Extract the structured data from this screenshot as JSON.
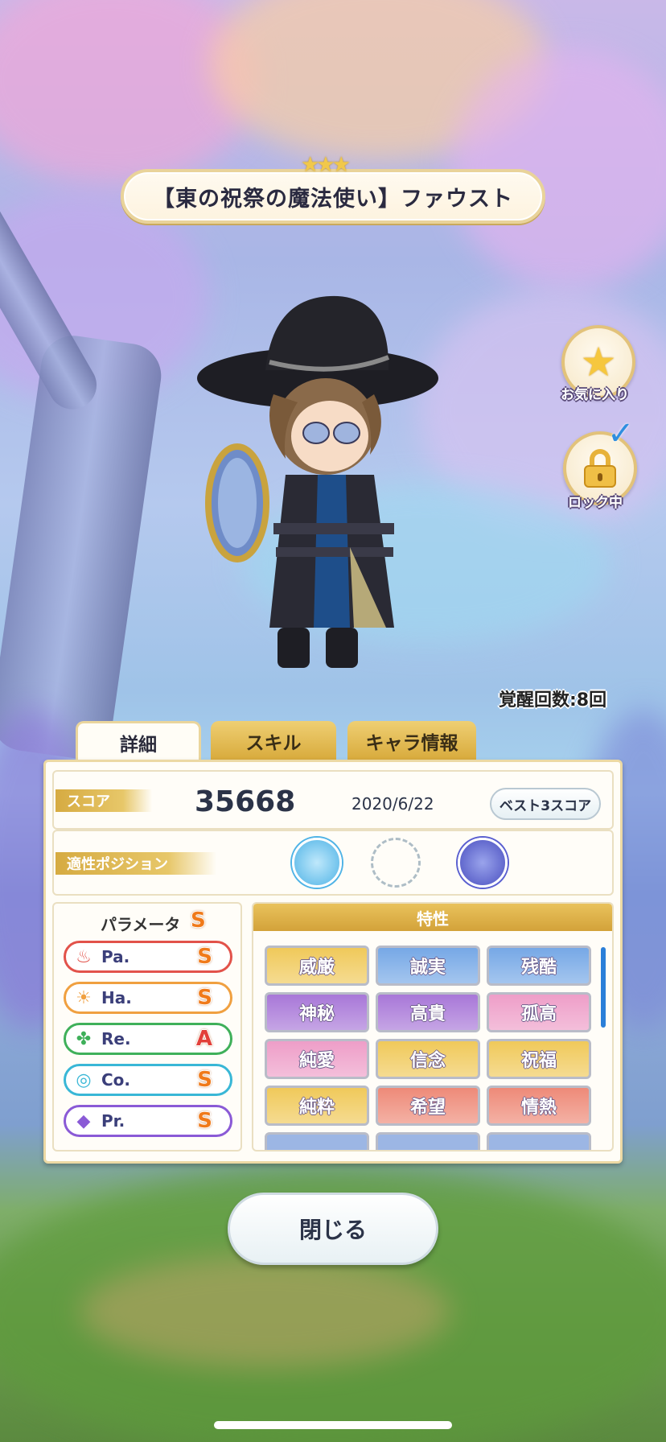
{
  "header": {
    "rarity_stars": "★★★",
    "card_title": "【東の祝祭の魔法使い】ファウスト"
  },
  "side_buttons": {
    "favorite_label": "お気に入り",
    "lock_label": "ロック中"
  },
  "awakening": "覚醒回数:8回",
  "tabs": [
    {
      "label": "詳細",
      "active": true
    },
    {
      "label": "スキル",
      "active": false
    },
    {
      "label": "キャラ情報",
      "active": false
    }
  ],
  "score": {
    "label": "スコア",
    "value": "35668",
    "date": "2020/6/22",
    "best_button": "ベスト3スコア"
  },
  "position": {
    "label": "適性ポジション"
  },
  "parameters": {
    "title": "パラメータ",
    "overall_rank": "S",
    "items": [
      {
        "name": "Pa.",
        "rank": "S",
        "color": "#e2524a",
        "icon": "flame-icon"
      },
      {
        "name": "Ha.",
        "rank": "S",
        "color": "#f0a040",
        "icon": "sun-icon"
      },
      {
        "name": "Re.",
        "rank": "A",
        "color": "#3fb05a",
        "icon": "clover-icon"
      },
      {
        "name": "Co.",
        "rank": "S",
        "color": "#39b7d6",
        "icon": "swirl-icon"
      },
      {
        "name": "Pr.",
        "rank": "S",
        "color": "#8a5ad6",
        "icon": "gem-icon"
      }
    ]
  },
  "traits": {
    "title": "特性",
    "items": [
      {
        "label": "威厳",
        "color": "#f0c95a"
      },
      {
        "label": "誠実",
        "color": "#76a8e6"
      },
      {
        "label": "残酷",
        "color": "#76a8e6"
      },
      {
        "label": "神秘",
        "color": "#a877d8"
      },
      {
        "label": "高貴",
        "color": "#a877d8"
      },
      {
        "label": "孤高",
        "color": "#ee9ec8"
      },
      {
        "label": "純愛",
        "color": "#ee9ec8"
      },
      {
        "label": "信念",
        "color": "#f0c95a"
      },
      {
        "label": "祝福",
        "color": "#f0c95a"
      },
      {
        "label": "純粋",
        "color": "#f0c95a"
      },
      {
        "label": "希望",
        "color": "#ee8a78"
      },
      {
        "label": "情熱",
        "color": "#ee8a78"
      }
    ]
  },
  "close_button": "閉じる"
}
